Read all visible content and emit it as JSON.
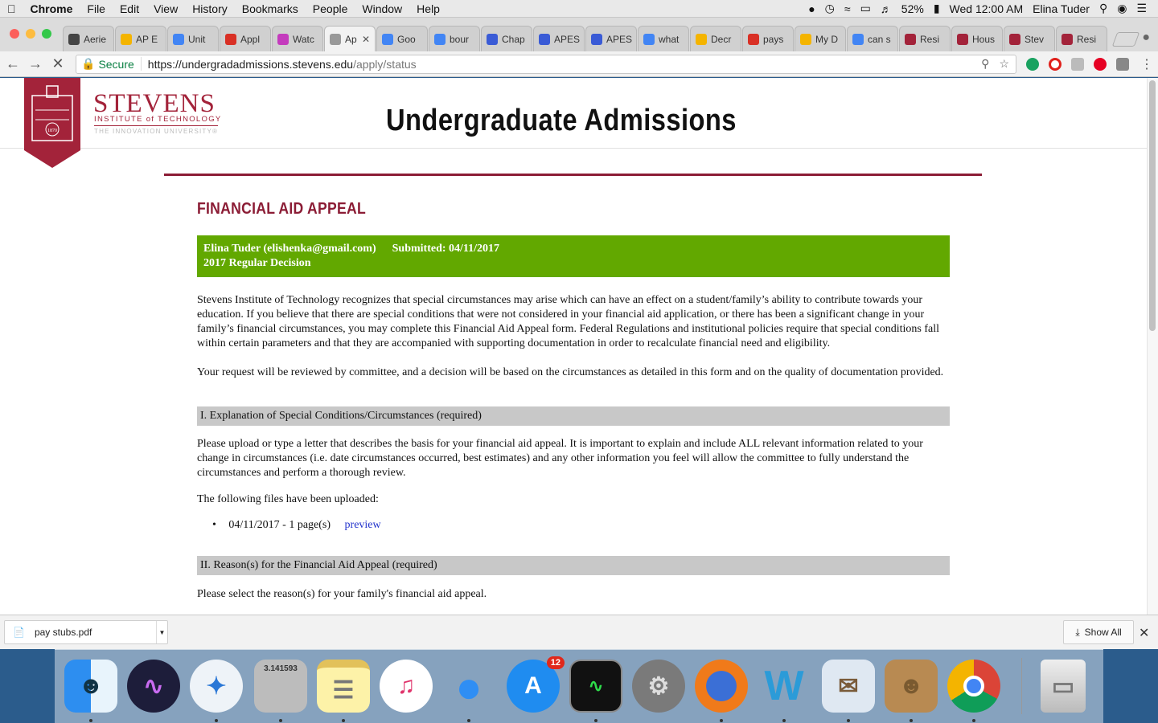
{
  "menubar": {
    "app": "Chrome",
    "items": [
      "File",
      "Edit",
      "View",
      "History",
      "Bookmarks",
      "People",
      "Window",
      "Help"
    ],
    "battery": "52%",
    "clock": "Wed 12:00 AM",
    "user": "Elina Tuder"
  },
  "tabs": [
    {
      "label": "Aerie",
      "icon": "aeo-icon",
      "color": "#444"
    },
    {
      "label": "AP E",
      "icon": "google-drive-icon",
      "color": "#f4b400"
    },
    {
      "label": "Unit",
      "icon": "google-docs-icon",
      "color": "#4285f4"
    },
    {
      "label": "Appl",
      "icon": "gmail-icon",
      "color": "#d93025"
    },
    {
      "label": "Watc",
      "icon": "video-icon",
      "color": "#c43bbd"
    },
    {
      "label": "Ap",
      "icon": "loading-icon",
      "color": "#999",
      "active": true
    },
    {
      "label": "Goo",
      "icon": "google-translate-icon",
      "color": "#4285f4"
    },
    {
      "label": "bour",
      "icon": "google-icon",
      "color": "#4285f4"
    },
    {
      "label": "Chap",
      "icon": "quizlet-icon",
      "color": "#3a5bd6"
    },
    {
      "label": "APES",
      "icon": "quizlet-icon",
      "color": "#3a5bd6"
    },
    {
      "label": "APES",
      "icon": "quizlet-icon",
      "color": "#3a5bd6"
    },
    {
      "label": "what",
      "icon": "google-icon",
      "color": "#4285f4"
    },
    {
      "label": "Decr",
      "icon": "slides-icon",
      "color": "#f4b400"
    },
    {
      "label": "pays",
      "icon": "gmail-icon",
      "color": "#d93025"
    },
    {
      "label": "My D",
      "icon": "google-drive-icon",
      "color": "#f4b400"
    },
    {
      "label": "can s",
      "icon": "google-icon",
      "color": "#4285f4"
    },
    {
      "label": "Resi",
      "icon": "stevens-icon",
      "color": "#a3233a"
    },
    {
      "label": "Hous",
      "icon": "stevens-icon",
      "color": "#a3233a"
    },
    {
      "label": "Stev",
      "icon": "stevens-icon",
      "color": "#a3233a"
    },
    {
      "label": "Resi",
      "icon": "stevens-icon",
      "color": "#a3233a"
    }
  ],
  "toolbar": {
    "secure_label": "Secure",
    "url_host": "https://undergradadmissions.stevens.edu",
    "url_path": "/apply/status"
  },
  "site": {
    "logo_name": "STEVENS",
    "logo_sub": "INSTITUTE of TECHNOLOGY",
    "logo_tag": "THE INNOVATION UNIVERSITY®",
    "logo_year": "1870",
    "title": "Undergraduate Admissions"
  },
  "form": {
    "title": "FINANCIAL AID APPEAL",
    "applicant": "Elina Tuder (elishenka@gmail.com)",
    "submitted": "Submitted: 04/11/2017",
    "decision": "2017 Regular Decision",
    "intro1": "Stevens Institute of Technology recognizes that special circumstances may arise which can have an effect on a student/family’s ability to contribute towards your education. If you believe that there are special conditions that were not considered in your financial aid application, or there has been a significant change in your family’s financial circumstances, you may complete this Financial Aid Appeal form. Federal Regulations and institutional policies require that special conditions fall within certain parameters and that they are accompanied with supporting documentation in order to recalculate financial need and eligibility.",
    "intro2": "Your request will be reviewed by committee, and a decision will be based on the circumstances as detailed in this form and on the quality of documentation provided.",
    "section1": {
      "header": "I. Explanation of Special Conditions/Circumstances (required)",
      "text": "Please upload or type a letter that describes the basis for your financial aid appeal. It is important to explain and include ALL relevant information related to your change in circumstances (i.e. date circumstances occurred, best estimates) and any other information you feel will allow the committee to fully understand the circumstances and perform a thorough review.",
      "uploaded_label": "The following files have been uploaded:",
      "file": "04/11/2017 - 1 page(s)",
      "preview": "preview"
    },
    "section2": {
      "header": "II. Reason(s) for the Financial Aid Appeal (required)",
      "text": "Please select the reason(s) for your family's financial aid appeal."
    }
  },
  "downloads": {
    "file": "pay stubs.pdf",
    "show_all": "Show All"
  },
  "dock": {
    "calculator_display": "3.141593",
    "appstore_badge": "12",
    "apps": [
      "finder-icon",
      "siri-icon",
      "safari-icon",
      "calculator-icon",
      "notes-icon",
      "itunes-icon",
      "messages-icon",
      "app-store-icon",
      "activity-monitor-icon",
      "system-preferences-icon",
      "firefox-icon",
      "word-icon",
      "mail-icon",
      "contacts-icon",
      "chrome-icon",
      "trash-icon"
    ]
  }
}
